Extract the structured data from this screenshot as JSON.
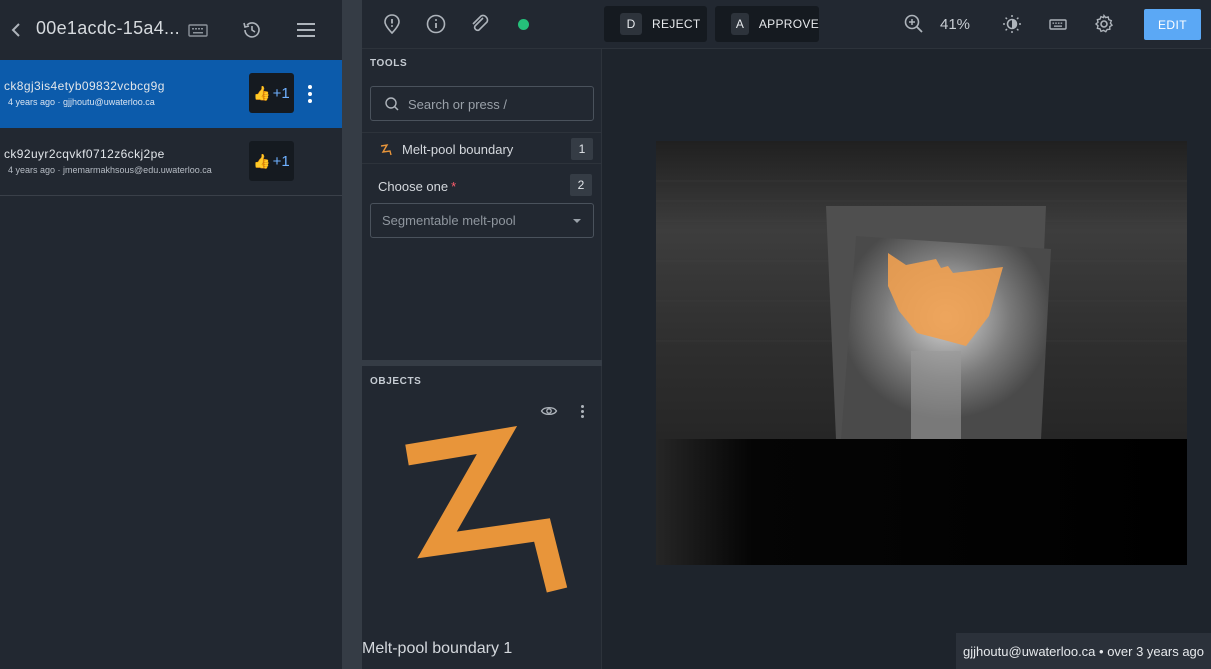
{
  "header": {
    "title": "00e1acdc-15a4..."
  },
  "labels": [
    {
      "id": "ck8gj3is4etyb09832vcbcg9g",
      "meta": "4 years ago · gjjhoutu@uwaterloo.ca",
      "vote": "+1",
      "selected": true
    },
    {
      "id": "ck92uyr2cqvkf0712z6ckj2pe",
      "meta": "4 years ago · jmemarmakhsous@edu.uwaterloo.ca",
      "vote": "+1",
      "selected": false
    }
  ],
  "toolbar": {
    "reject_key": "D",
    "reject_label": "REJECT",
    "approve_key": "A",
    "approve_label": "APPROVE",
    "zoom": "41%",
    "edit_label": "EDIT",
    "status_color": "#25c07a"
  },
  "tools": {
    "section_title": "TOOLS",
    "search_placeholder": "Search or press /",
    "items": [
      {
        "label": "Melt-pool boundary",
        "shortcut": "1",
        "icon": "polygon-tool-icon"
      }
    ],
    "classification": {
      "label": "Choose one",
      "required_mark": "*",
      "shortcut": "2",
      "selected": "Segmentable melt-pool"
    }
  },
  "objects": {
    "section_title": "OBJECTS",
    "items": [
      {
        "label": "Melt-pool boundary 1",
        "icon": "polygon-tool-icon"
      }
    ]
  },
  "footer": {
    "info": "gjjhoutu@uwaterloo.ca • over 3 years ago"
  },
  "colors": {
    "accent": "#5ba8f5",
    "selected_row": "#0c5bab",
    "annotation_fill": "#f0a050",
    "tool_icon": "#e8953a"
  }
}
